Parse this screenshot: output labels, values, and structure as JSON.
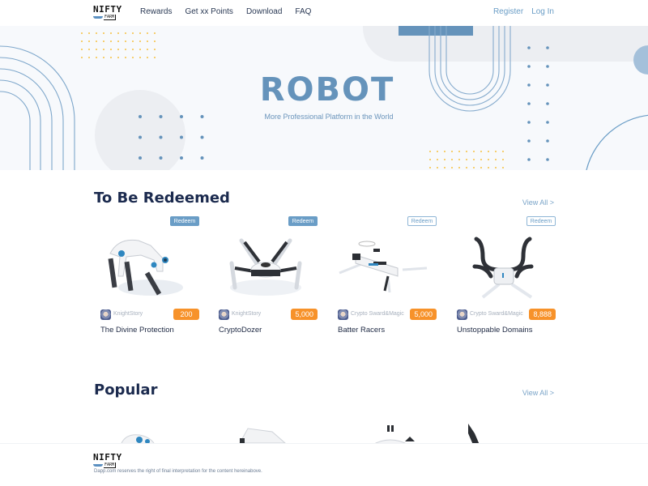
{
  "header": {
    "logo": {
      "text": "NIFTY",
      "sub": "FARM"
    },
    "nav": [
      "Rewards",
      "Get xx Points",
      "Download",
      "FAQ"
    ],
    "register": "Register",
    "login": "Log In"
  },
  "hero": {
    "title": "ROBOT",
    "subtitle": "More Professional Platform in the World"
  },
  "colors": {
    "accent": "#6593bb",
    "price": "#f7922a",
    "heading": "#1b2a4e",
    "dot_yellow": "#f5c242"
  },
  "redeemed": {
    "title": "To Be Redeemed",
    "view_all": "View All >",
    "items": [
      {
        "badge": "Redeem",
        "badge_style": "filled",
        "creator": "KnightStory",
        "price": "200",
        "name": "The Divine Protection"
      },
      {
        "badge": "Redeem",
        "badge_style": "filled",
        "creator": "KnightStory",
        "price": "5,000",
        "name": "CryptoDozer"
      },
      {
        "badge": "Redeem",
        "badge_style": "outline",
        "creator": "Crypto Sward&Magic",
        "price": "5,000",
        "name": "Batter Racers"
      },
      {
        "badge": "Redeem",
        "badge_style": "outline",
        "creator": "Crypto Sward&Magic",
        "price": "8,888",
        "name": "Unstoppable Domains"
      }
    ]
  },
  "popular": {
    "title": "Popular",
    "view_all": "View All >"
  },
  "footer": {
    "logo": {
      "text": "NIFTY",
      "sub": "FARM"
    },
    "disclaimer": "Dapp.com reserves the right of final interpretation for the content hereinabove."
  }
}
